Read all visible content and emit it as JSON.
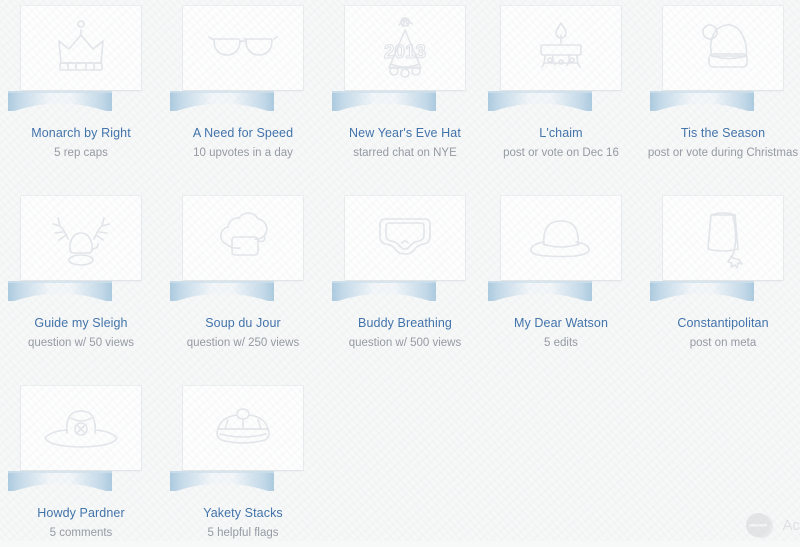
{
  "page": {
    "background_color": "#f7f8f8",
    "card_color": "#fefefe",
    "title_color": "#3a6ea8",
    "desc_color": "#9197a0",
    "ribbon_color": "#b9d4e6"
  },
  "watermark": {
    "label": "Ac",
    "icon": "chat-bubble-icon"
  },
  "hats": [
    {
      "title": "Monarch by Right",
      "description": "5 rep caps",
      "icon": "crown-icon",
      "col": 0,
      "row": 0
    },
    {
      "title": "A Need for Speed",
      "description": "10 upvotes in a day",
      "icon": "aviator-sunglasses-icon",
      "col": 1,
      "row": 0
    },
    {
      "title": "New Year's Eve Hat",
      "description": "starred chat on NYE",
      "icon": "party-hat-2013-icon",
      "col": 2,
      "row": 0
    },
    {
      "title": "L'chaim",
      "description": "post or vote on Dec 16",
      "icon": "menorah-candle-icon",
      "col": 3,
      "row": 0
    },
    {
      "title": "Tis the Season",
      "description": "post or vote during Christmas",
      "icon": "santa-hat-icon",
      "col": 4,
      "row": 0
    },
    {
      "title": "Guide my Sleigh",
      "description": "question w/ 50 views",
      "icon": "reindeer-antlers-icon",
      "col": 0,
      "row": 1
    },
    {
      "title": "Soup du Jour",
      "description": "question w/ 250 views",
      "icon": "chef-hat-icon",
      "col": 1,
      "row": 1
    },
    {
      "title": "Buddy Breathing",
      "description": "question w/ 500 views",
      "icon": "diving-mask-icon",
      "col": 2,
      "row": 1
    },
    {
      "title": "My Dear Watson",
      "description": "5 edits",
      "icon": "bowler-hat-icon",
      "col": 3,
      "row": 1
    },
    {
      "title": "Constantipolitan",
      "description": "post on meta",
      "icon": "fez-hat-icon",
      "col": 4,
      "row": 1
    },
    {
      "title": "Howdy Pardner",
      "description": "5 comments",
      "icon": "cowboy-hat-icon",
      "col": 0,
      "row": 2
    },
    {
      "title": "Yakety Stacks",
      "description": "5 helpful flags",
      "icon": "sailor-cap-icon",
      "col": 1,
      "row": 2
    }
  ]
}
